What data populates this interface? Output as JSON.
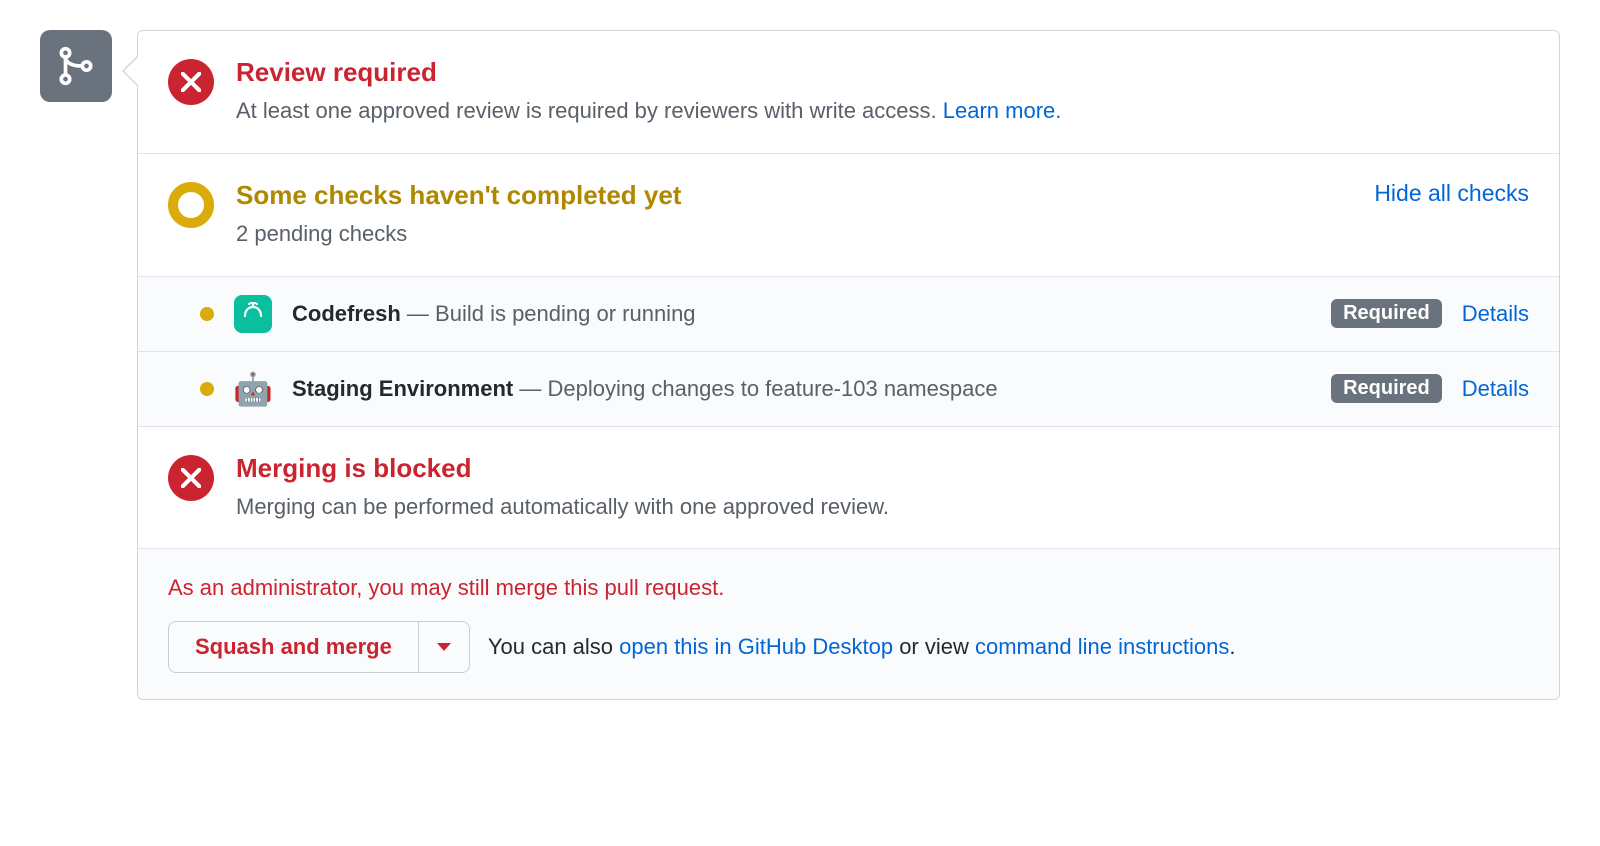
{
  "review": {
    "title": "Review required",
    "desc": "At least one approved review is required by reviewers with write access.",
    "learn_more": "Learn more."
  },
  "checks_summary": {
    "title": "Some checks haven't completed yet",
    "sub": "2 pending checks",
    "toggle": "Hide all checks"
  },
  "checks": [
    {
      "app": "Codefresh",
      "status_text": "Build is pending or running",
      "required": "Required",
      "details": "Details",
      "icon": "codefresh-icon"
    },
    {
      "app": "Staging Environment",
      "status_text": "Deploying changes to feature-103 namespace",
      "required": "Required",
      "details": "Details",
      "icon": "robot-icon"
    }
  ],
  "blocked": {
    "title": "Merging is blocked",
    "desc": "Merging can be performed automatically with one approved review."
  },
  "footer": {
    "admin_note": "As an administrator, you may still merge this pull request.",
    "merge_btn": "Squash and merge",
    "also_prefix": "You can also ",
    "desktop_link": "open this in GitHub Desktop",
    "or_view": " or view ",
    "cli_link": "command line instructions",
    "period": "."
  }
}
